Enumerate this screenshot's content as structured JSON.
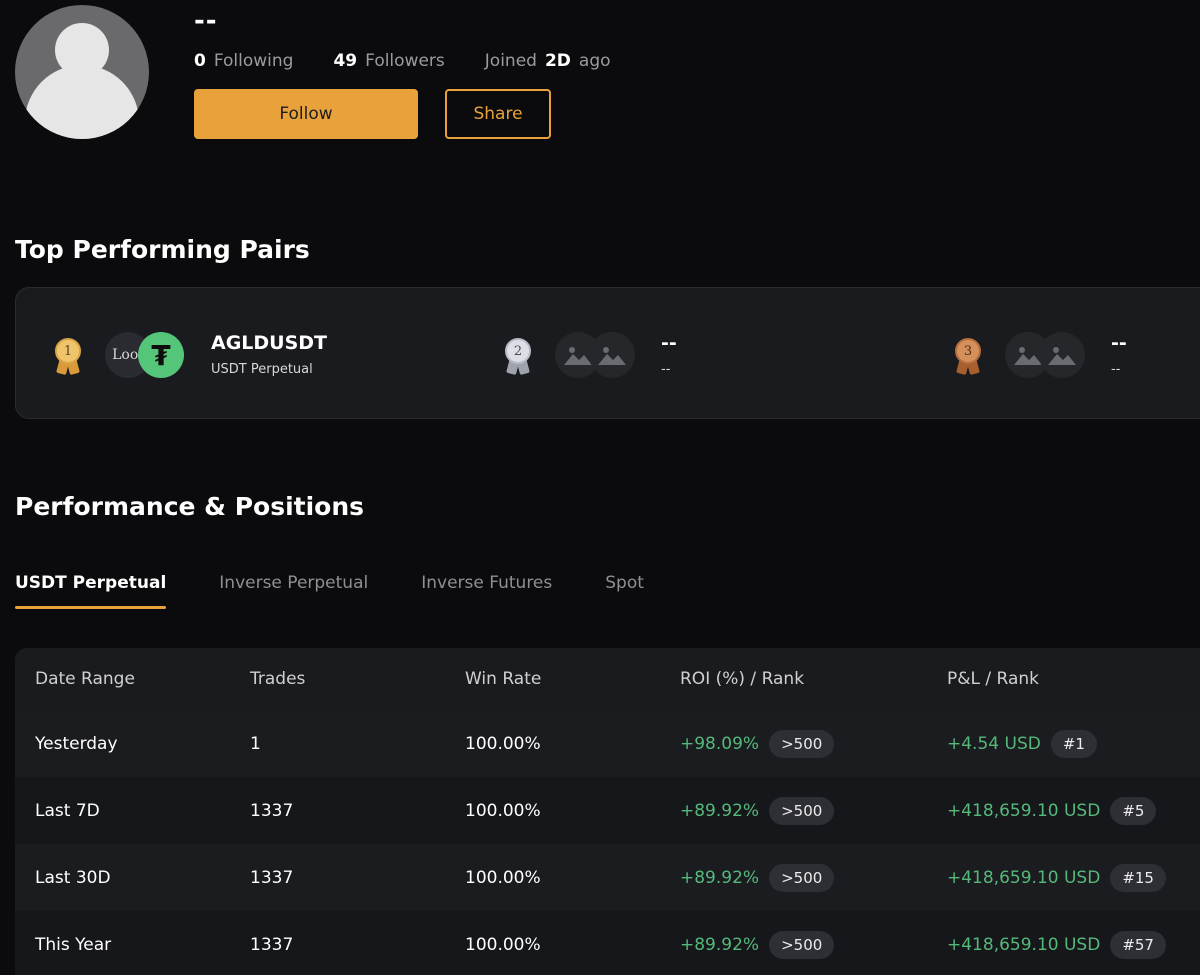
{
  "profile": {
    "username": "--",
    "following_count": "0",
    "following_label": "Following",
    "followers_count": "49",
    "followers_label": "Followers",
    "joined_prefix": "Joined",
    "joined_value": "2D",
    "joined_suffix": "ago",
    "follow_label": "Follow",
    "share_label": "Share"
  },
  "top_pairs": {
    "title": "Top Performing Pairs",
    "pairs": [
      {
        "rank": "1",
        "name": "AGLDUSDT",
        "sub": "USDT Perpetual",
        "coin_a": "Loot"
      },
      {
        "rank": "2",
        "name": "--",
        "sub": "--"
      },
      {
        "rank": "3",
        "name": "--",
        "sub": "--"
      }
    ]
  },
  "performance": {
    "title": "Performance & Positions",
    "tabs": [
      "USDT Perpetual",
      "Inverse Perpetual",
      "Inverse Futures",
      "Spot"
    ],
    "active_tab": 0,
    "columns": [
      "Date Range",
      "Trades",
      "Win Rate",
      "ROI (%) / Rank",
      "P&L / Rank"
    ],
    "rows": [
      {
        "range": "Yesterday",
        "trades": "1",
        "win_rate": "100.00%",
        "roi": "+98.09%",
        "roi_rank": ">500",
        "pnl": "+4.54 USD",
        "pnl_rank": "#1"
      },
      {
        "range": "Last 7D",
        "trades": "1337",
        "win_rate": "100.00%",
        "roi": "+89.92%",
        "roi_rank": ">500",
        "pnl": "+418,659.10 USD",
        "pnl_rank": "#5"
      },
      {
        "range": "Last 30D",
        "trades": "1337",
        "win_rate": "100.00%",
        "roi": "+89.92%",
        "roi_rank": ">500",
        "pnl": "+418,659.10 USD",
        "pnl_rank": "#15"
      },
      {
        "range": "This Year",
        "trades": "1337",
        "win_rate": "100.00%",
        "roi": "+89.92%",
        "roi_rank": ">500",
        "pnl": "+418,659.10 USD",
        "pnl_rank": "#57"
      }
    ]
  },
  "colors": {
    "accent": "#e9a23b",
    "positive": "#55b97a",
    "background": "#0b0b0d",
    "gold": "#e8b75a",
    "silver": "#c9ccd3",
    "bronze": "#c47a45"
  },
  "icons": [
    "avatar-placeholder",
    "gold-medal-icon",
    "silver-medal-icon",
    "bronze-medal-icon",
    "tether-icon",
    "image-placeholder-icon"
  ]
}
